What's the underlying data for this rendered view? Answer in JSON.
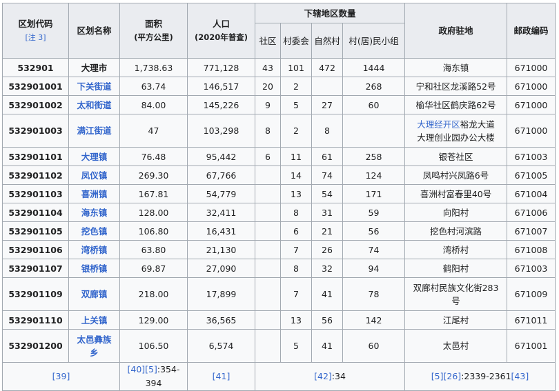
{
  "headers": {
    "code": "区划代码",
    "code_note": "[注 3]",
    "name": "区划名称",
    "area": "面积",
    "area_unit": "(平方公里)",
    "population": "人口",
    "population_sub": "(2020年普查)",
    "subdiv": "下辖地区数量",
    "sub_community": "社区",
    "sub_village_committee": "村委会",
    "sub_natural_village": "自然村",
    "sub_group": "村(居)民小组",
    "seat": "政府驻地",
    "postal": "邮政编码"
  },
  "rows": [
    {
      "code": "532901",
      "name": "大理市",
      "area": "1,738.63",
      "population": "771,128",
      "community": "43",
      "village_committee": "101",
      "natural_village": "472",
      "group": "1444",
      "seat": "海东镇",
      "postal": "671000"
    },
    {
      "code": "532901001",
      "name": "下关街道",
      "area": "63.74",
      "population": "146,517",
      "community": "20",
      "village_committee": "2",
      "natural_village": "",
      "group": "268",
      "seat": "宁和社区龙溪路52号",
      "postal": "671000"
    },
    {
      "code": "532901002",
      "name": "太和街道",
      "area": "84.00",
      "population": "145,226",
      "community": "9",
      "village_committee": "5",
      "natural_village": "27",
      "group": "60",
      "seat": "榆华社区鹤庆路62号",
      "postal": "671000"
    },
    {
      "code": "532901003",
      "name": "满江街道",
      "area": "47",
      "population": "103,298",
      "community": "8",
      "village_committee": "2",
      "natural_village": "8",
      "group": "",
      "seat_link": "大理经开区",
      "seat": "裕龙大道",
      "seat_line2": "大理创业园办公大楼",
      "postal": "671000"
    },
    {
      "code": "532901101",
      "name": "大理镇",
      "area": "76.48",
      "population": "95,442",
      "community": "6",
      "village_committee": "11",
      "natural_village": "61",
      "group": "258",
      "seat": "银苍社区",
      "postal": "671003"
    },
    {
      "code": "532901102",
      "name": "凤仪镇",
      "area": "269.30",
      "population": "67,766",
      "community": "",
      "village_committee": "14",
      "natural_village": "74",
      "group": "124",
      "seat": "凤鸣村兴凤路6号",
      "postal": "671005"
    },
    {
      "code": "532901103",
      "name": "喜洲镇",
      "area": "167.81",
      "population": "54,779",
      "community": "",
      "village_committee": "13",
      "natural_village": "54",
      "group": "171",
      "seat": "喜洲村富春里40号",
      "postal": "671004"
    },
    {
      "code": "532901104",
      "name": "海东镇",
      "area": "128.00",
      "population": "32,411",
      "community": "",
      "village_committee": "8",
      "natural_village": "31",
      "group": "59",
      "seat": "向阳村",
      "postal": "671006"
    },
    {
      "code": "532901105",
      "name": "挖色镇",
      "area": "106.80",
      "population": "16,431",
      "community": "",
      "village_committee": "6",
      "natural_village": "21",
      "group": "56",
      "seat": "挖色村河滨路",
      "postal": "671007"
    },
    {
      "code": "532901106",
      "name": "湾桥镇",
      "area": "63.80",
      "population": "21,130",
      "community": "",
      "village_committee": "7",
      "natural_village": "26",
      "group": "74",
      "seat": "湾桥村",
      "postal": "671008"
    },
    {
      "code": "532901107",
      "name": "银桥镇",
      "area": "69.87",
      "population": "27,090",
      "community": "",
      "village_committee": "8",
      "natural_village": "32",
      "group": "94",
      "seat": "鹤阳村",
      "postal": "671003"
    },
    {
      "code": "532901109",
      "name": "双廊镇",
      "area": "218.00",
      "population": "17,899",
      "community": "",
      "village_committee": "7",
      "natural_village": "41",
      "group": "78",
      "seat": "双廊村民族文化街283",
      "seat_line2": "号",
      "postal": "671009"
    },
    {
      "code": "532901110",
      "name": "上关镇",
      "area": "129.00",
      "population": "36,565",
      "community": "",
      "village_committee": "13",
      "natural_village": "56",
      "group": "142",
      "seat": "江尾村",
      "postal": "671011"
    },
    {
      "code": "532901200",
      "name": "太邑彝族",
      "name_line2": "乡",
      "area": "106.50",
      "population": "6,574",
      "community": "",
      "village_committee": "5",
      "natural_village": "41",
      "group": "60",
      "seat": "太邑村",
      "postal": "671001"
    }
  ],
  "footer": {
    "ref_code": "[39]",
    "ref_area_a": "[40]",
    "ref_area_b": "[5]",
    "ref_area_pages": ":354-394",
    "ref_population": "[41]",
    "ref_subdiv": "[42]",
    "ref_subdiv_pages": ":34",
    "ref_seat_a": "[5]",
    "ref_seat_b": "[26]",
    "ref_seat_pages": ":2339-2361",
    "ref_seat_c": "[43]"
  },
  "colors": {
    "link": "#3366cc",
    "header_bg": "#eaecf0",
    "cell_bg": "#f8f9fa",
    "border": "#a2a9b1"
  }
}
